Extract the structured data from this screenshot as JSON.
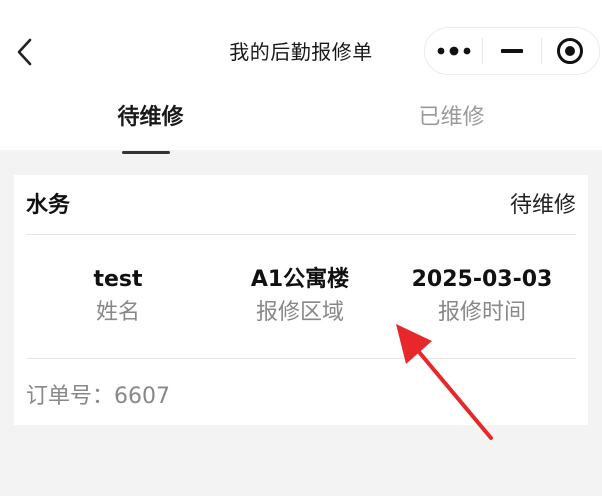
{
  "navbar": {
    "title": "我的后勤报修单",
    "back_icon": "chevron-left-icon",
    "more_icon": "more-dots-icon",
    "minimize_icon": "minus-icon",
    "close_icon": "target-circle-icon"
  },
  "tabs": [
    {
      "label": "待维修",
      "active": true
    },
    {
      "label": "已维修",
      "active": false
    }
  ],
  "orders": [
    {
      "type": "水务",
      "status": "待维修",
      "fields": [
        {
          "value": "test",
          "label": "姓名"
        },
        {
          "value": "A1公寓楼",
          "label": "报修区域"
        },
        {
          "value": "2025-03-03",
          "label": "报修时间"
        }
      ],
      "order_no": "订单号：6607"
    }
  ],
  "colors": {
    "annotation_arrow": "#e8272b",
    "page_background": "#f3f3f3",
    "card_background": "#ffffff"
  }
}
